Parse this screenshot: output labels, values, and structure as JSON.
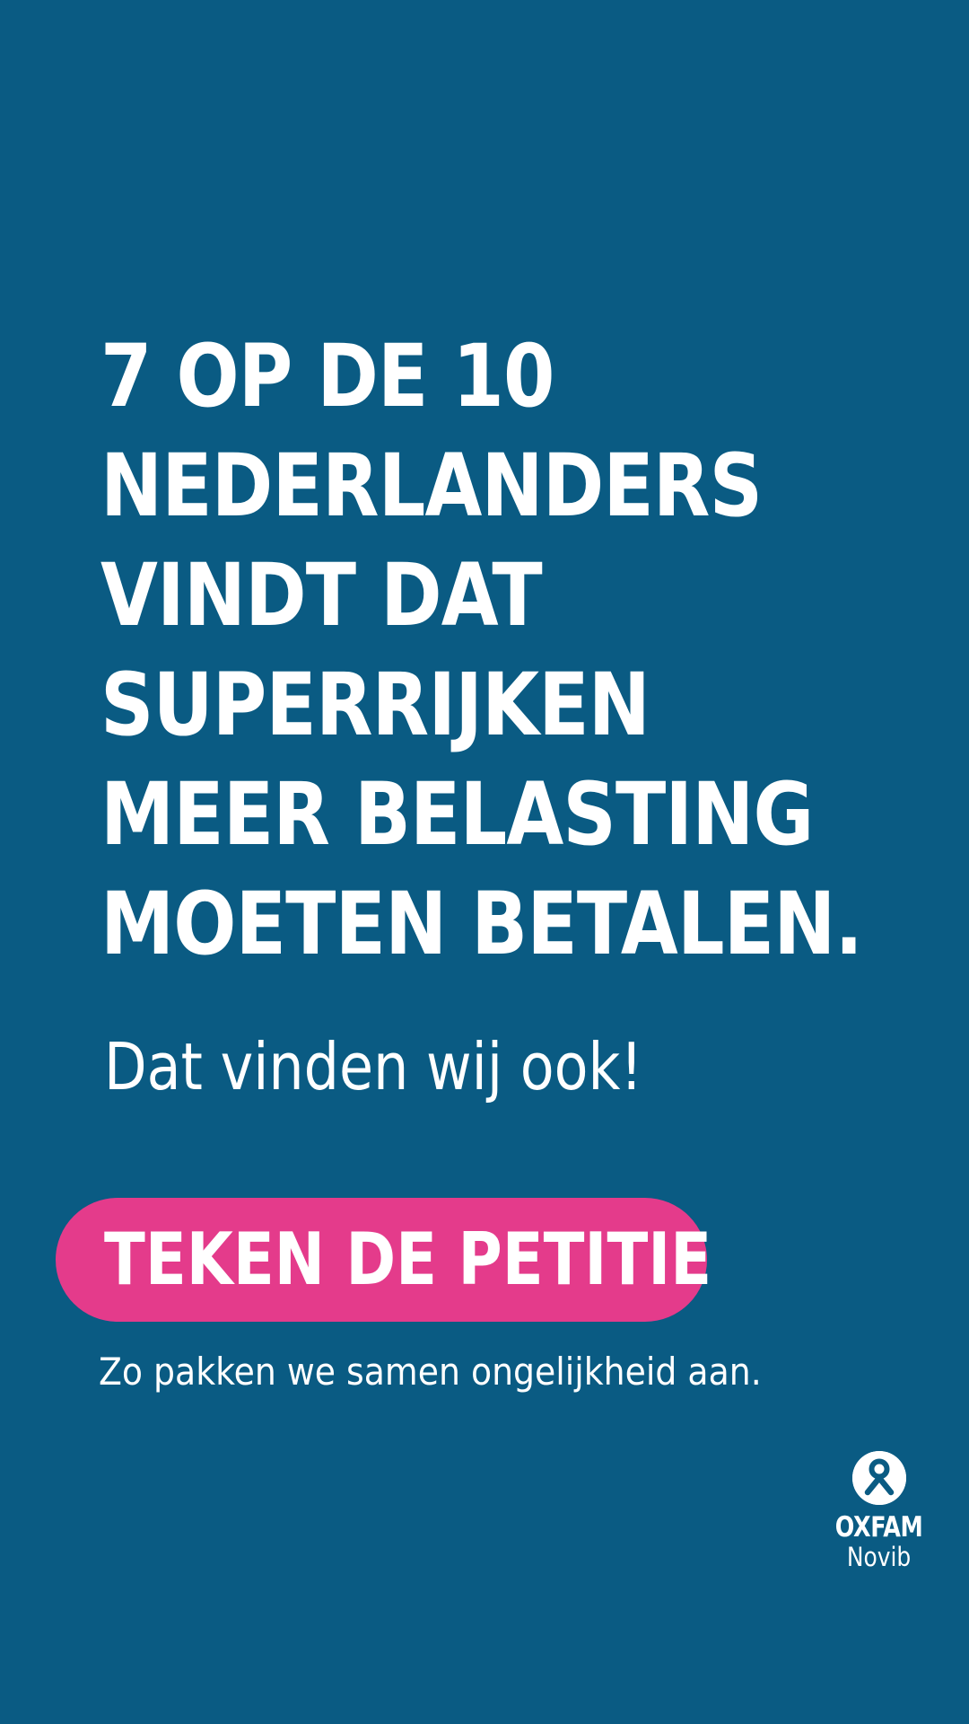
{
  "headline": {
    "lines": [
      "7 OP DE 10",
      "NEDERLANDERS",
      "VINDT DAT",
      "SUPERRIJKEN",
      "MEER BELASTING",
      "MOETEN BETALEN."
    ]
  },
  "subhead": "Dat vinden wij ook!",
  "cta": {
    "label": "TEKEN DE PETITIE"
  },
  "tagline": "Zo pakken we samen ongelijkheid aan.",
  "logo": {
    "icon": "oxfam-logo-icon",
    "name": "OXFAM",
    "sub": "Novib"
  },
  "colors": {
    "background": "#0a5b83",
    "button": "#e43b8b",
    "text": "#ffffff"
  }
}
